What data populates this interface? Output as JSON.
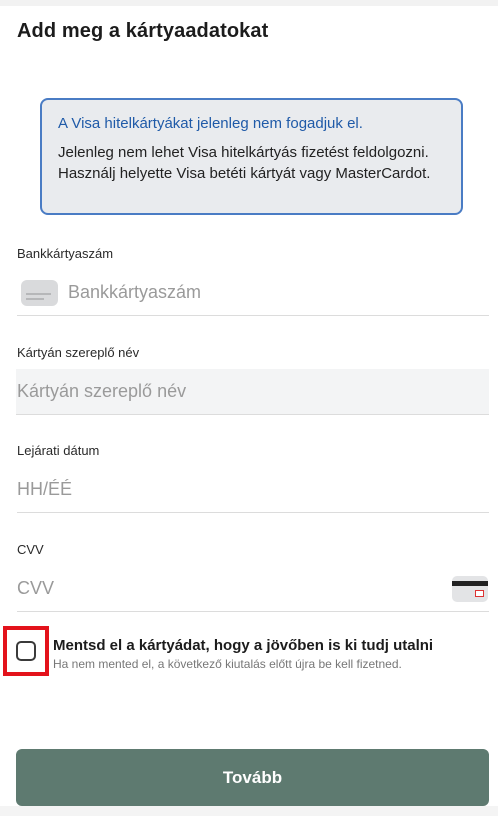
{
  "page": {
    "title": "Add meg a kártyaadatokat"
  },
  "notice": {
    "title": "A Visa hitelkártyákat jelenleg nem fogadjuk el.",
    "body": "Jelenleg nem lehet Visa hitelkártyás fizetést feldolgoz­ni. Használj helyette Visa betéti kártyát vagy Master­Cardot."
  },
  "fields": {
    "card_number": {
      "label": "Bankkártyaszám",
      "placeholder": "Bankkártyaszám",
      "icon": "card-icon"
    },
    "cardholder_name": {
      "label": "Kártyán szereplő név",
      "placeholder": "Kártyán szereplő név"
    },
    "expiry": {
      "label": "Lejárati dátum",
      "placeholder": "HH/ÉÉ"
    },
    "cvv": {
      "label": "CVV",
      "placeholder": "CVV",
      "icon": "card-back-cvv-icon"
    }
  },
  "save_card": {
    "checked": false,
    "title": "Mentsd el a kártyádat, hogy a jövőben is ki tudj utalni",
    "subtitle": "Ha nem mented el, a következő kiutalás előtt újra be kell fizetned."
  },
  "actions": {
    "continue_label": "Tovább"
  },
  "colors": {
    "notice_border": "#4a7cc4",
    "notice_title": "#1f5aa8",
    "notice_background": "#e9ebee",
    "button_background": "#5e7a70",
    "highlight_box": "#e3121b"
  }
}
